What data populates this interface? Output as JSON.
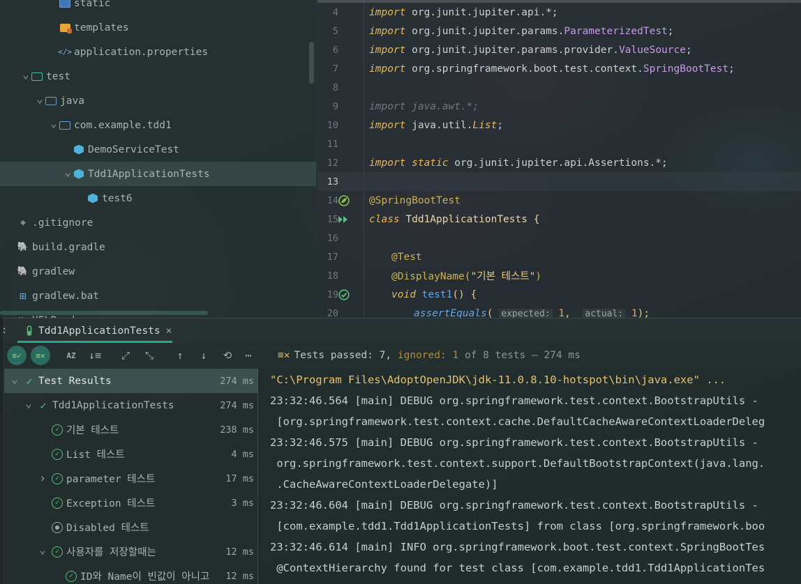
{
  "project_tree": [
    {
      "label": "static",
      "icon": "folder-web-icon",
      "indent": 3
    },
    {
      "label": "templates",
      "icon": "folder-templates-icon",
      "indent": 3
    },
    {
      "label": "application.properties",
      "icon": "properties-file-icon",
      "indent": 3
    },
    {
      "label": "test",
      "icon": "folder-test-icon",
      "indent": 1,
      "expanded": true
    },
    {
      "label": "java",
      "icon": "folder-icon",
      "indent": 2,
      "expanded": true
    },
    {
      "label": "com.example.tdd1",
      "icon": "package-icon",
      "indent": 3,
      "expanded": true
    },
    {
      "label": "DemoServiceTest",
      "icon": "test-class-icon",
      "indent": 4
    },
    {
      "label": "Tdd1ApplicationTests",
      "icon": "test-class-icon",
      "indent": 4,
      "expanded": true,
      "selected": true
    },
    {
      "label": "test6",
      "icon": "test-class-icon",
      "indent": 5
    },
    {
      "label": ".gitignore",
      "icon": "git-icon",
      "indent": 0
    },
    {
      "label": "build.gradle",
      "icon": "gradle-icon",
      "indent": 0
    },
    {
      "label": "gradlew",
      "icon": "gradle-icon",
      "indent": 0
    },
    {
      "label": "gradlew.bat",
      "icon": "windows-icon",
      "indent": 0
    },
    {
      "label": "HELP.md",
      "icon": "markdown-icon",
      "indent": 0
    }
  ],
  "editor": {
    "lines": [
      {
        "n": "4"
      },
      {
        "n": "5"
      },
      {
        "n": "6"
      },
      {
        "n": "7"
      },
      {
        "n": "8"
      },
      {
        "n": "9"
      },
      {
        "n": "10"
      },
      {
        "n": "11"
      },
      {
        "n": "12"
      },
      {
        "n": "13"
      },
      {
        "n": "14"
      },
      {
        "n": "15"
      },
      {
        "n": "16"
      },
      {
        "n": "17"
      },
      {
        "n": "18"
      },
      {
        "n": "19"
      },
      {
        "n": "20"
      }
    ],
    "code": {
      "l4": [
        "import",
        " org.junit.jupiter.api.*;"
      ],
      "l5": [
        "import",
        " org.junit.jupiter.params.",
        "ParameterizedTest",
        ";"
      ],
      "l6": [
        "import",
        " org.junit.jupiter.params.provider.",
        "ValueSource",
        ";"
      ],
      "l7": [
        "import",
        " org.springframework.boot.test.context.",
        "SpringBootTest",
        ";"
      ],
      "l9": "import java.awt.*;",
      "l10": [
        "import",
        " java.util.",
        "List",
        ";"
      ],
      "l12": [
        "import",
        " static",
        " org.junit.jupiter.api.Assertions.*;"
      ],
      "l14": "@SpringBootTest",
      "l15": [
        "class",
        " Tdd1ApplicationTests {"
      ],
      "l17": "@Test",
      "l18": [
        "@DisplayName(",
        "\"기본 테스트\"",
        ")"
      ],
      "l19": [
        "void",
        " test1",
        "() {"
      ],
      "l20": [
        "assertEquals",
        "(",
        "expected:",
        " 1",
        ", ",
        "actual:",
        " 1",
        ");"
      ]
    }
  },
  "run_window": {
    "prefix": ":",
    "tab_label": "Tdd1ApplicationTests",
    "close": "×",
    "status": {
      "passed": "Tests passed: 7,",
      "ignored": "ignored: 1",
      "of": "of 8 tests",
      "time": "– 274 ms"
    },
    "toolbar": [
      {
        "name": "show-passed-button",
        "glyph": "≡✓",
        "active": true
      },
      {
        "name": "show-ignored-button",
        "glyph": "≡✕",
        "active": true
      },
      {
        "name": "sort-alpha-button",
        "glyph": "AZ"
      },
      {
        "name": "sort-duration-button",
        "glyph": "↓≡"
      },
      {
        "name": "expand-all-button",
        "glyph": "⤢"
      },
      {
        "name": "collapse-all-button",
        "glyph": "⤡"
      },
      {
        "name": "previous-failed-button",
        "glyph": "↑"
      },
      {
        "name": "next-failed-button",
        "glyph": "↓"
      },
      {
        "name": "test-history-button",
        "glyph": "⟲"
      },
      {
        "name": "more-options-button",
        "glyph": "⋯"
      }
    ]
  },
  "test_results": [
    {
      "label": "Test Results",
      "time": "274 ms",
      "indent": 0,
      "expanded": true,
      "selected": true,
      "status": "passed-partial"
    },
    {
      "label": "Tdd1ApplicationTests",
      "time": "274 ms",
      "indent": 1,
      "expanded": true,
      "status": "passed-partial"
    },
    {
      "label": "기본 테스트",
      "time": "238 ms",
      "indent": 2,
      "status": "passed"
    },
    {
      "label": "List 테스트",
      "time": "4 ms",
      "indent": 2,
      "status": "passed"
    },
    {
      "label": "parameter 테스트",
      "time": "17 ms",
      "indent": 2,
      "collapsed": true,
      "status": "passed"
    },
    {
      "label": "Exception 테스트",
      "time": "3 ms",
      "indent": 2,
      "status": "passed"
    },
    {
      "label": "Disabled 테스트",
      "time": "",
      "indent": 2,
      "status": "ignored"
    },
    {
      "label": "사용자를 저장할때는",
      "time": "12 ms",
      "indent": 2,
      "expanded": true,
      "status": "passed"
    },
    {
      "label": "ID와 Name이 빈값이 아니고",
      "time": "12 ms",
      "indent": 3,
      "status": "passed"
    }
  ],
  "console": [
    {
      "text": "\"C:\\Program Files\\AdoptOpenJDK\\jdk-11.0.8.10-hotspot\\bin\\java.exe\" ...",
      "yellow": true
    },
    {
      "text": "23:32:46.564 [main] DEBUG org.springframework.test.context.BootstrapUtils -"
    },
    {
      "text": " [org.springframework.test.context.cache.DefaultCacheAwareContextLoaderDeleg"
    },
    {
      "text": "23:32:46.575 [main] DEBUG org.springframework.test.context.BootstrapUtils -"
    },
    {
      "text": " org.springframework.test.context.support.DefaultBootstrapContext(java.lang."
    },
    {
      "text": " .CacheAwareContextLoaderDelegate)]"
    },
    {
      "text": "23:32:46.604 [main] DEBUG org.springframework.test.context.BootstrapUtils -"
    },
    {
      "text": " [com.example.tdd1.Tdd1ApplicationTests] from class [org.springframework.boo"
    },
    {
      "text": "23:32:46.614 [main] INFO org.springframework.boot.test.context.SpringBootTes"
    },
    {
      "text": " @ContextHierarchy found for test class [com.example.tdd1.Tdd1ApplicationTes"
    }
  ]
}
